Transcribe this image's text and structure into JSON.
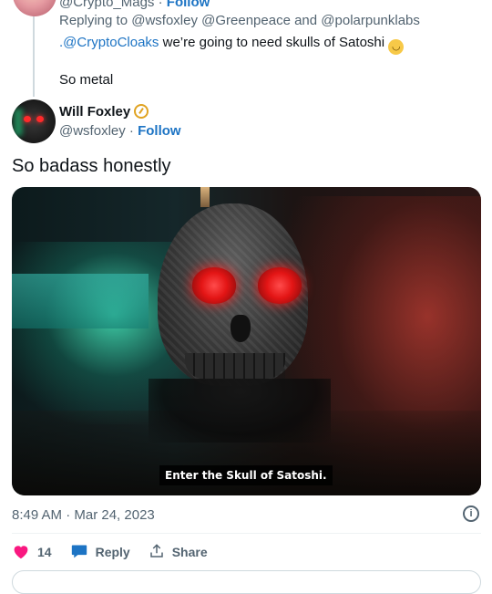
{
  "parent_tweet": {
    "handle": "@Crypto_Mags",
    "follow_label": "Follow",
    "replying_to_prefix": "Replying to",
    "replying_to": "@wsfoxley @Greenpeace and @polarpunklabs",
    "mention_prefix": ".",
    "mention": "@CryptoCloaks",
    "body": " we’re going to need skulls of Satoshi",
    "body2": "So metal"
  },
  "tweet": {
    "name": "Will Foxley",
    "handle": "@wsfoxley",
    "dot": " · ",
    "follow_label": "Follow",
    "text": "So badass honestly",
    "caption": "Enter the Skull of Satoshi.",
    "timestamp": "8:49 AM · Mar 24, 2023",
    "likes": "14",
    "reply_label": "Reply",
    "share_label": "Share"
  },
  "colors": {
    "accent": "#1d74c4",
    "like": "#f91880",
    "muted": "#536471"
  },
  "icons": [
    "heart-icon",
    "reply-icon",
    "share-icon",
    "info-icon",
    "verified-badge-icon"
  ]
}
